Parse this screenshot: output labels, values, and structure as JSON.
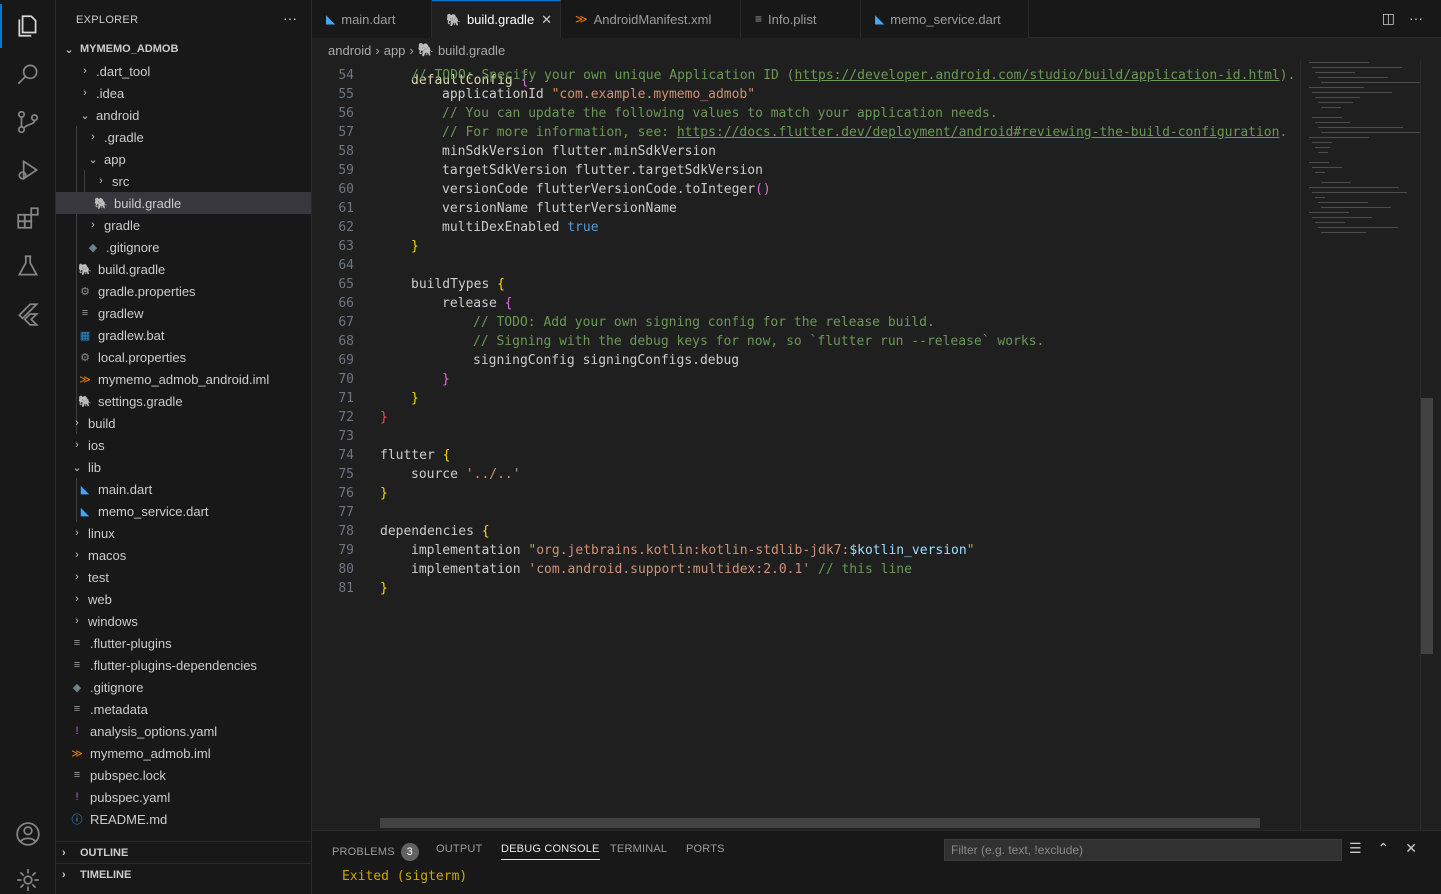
{
  "activity_bar": {
    "icons": [
      "explorer-icon",
      "search-icon",
      "source-control-icon",
      "run-debug-icon",
      "extensions-icon",
      "testing-icon",
      "flutter-icon",
      "account-icon",
      "settings-gear-icon"
    ]
  },
  "sidebar": {
    "title": "EXPLORER",
    "more": "···",
    "project": "MYMEMO_ADMOB",
    "items": [
      {
        "label": ".dart_tool",
        "chev": "›",
        "icon": ""
      },
      {
        "label": ".idea",
        "chev": "›",
        "icon": ""
      },
      {
        "label": "android",
        "chev": "⌄",
        "icon": ""
      },
      {
        "label": ".gradle",
        "chev": "›",
        "icon": ""
      },
      {
        "label": "app",
        "chev": "⌄",
        "icon": ""
      },
      {
        "label": "src",
        "chev": "›",
        "icon": ""
      },
      {
        "label": "build.gradle",
        "chev": "",
        "icon": "🐘"
      },
      {
        "label": "gradle",
        "chev": "›",
        "icon": ""
      },
      {
        "label": ".gitignore",
        "chev": "",
        "icon": "◆"
      },
      {
        "label": "build.gradle",
        "chev": "",
        "icon": "🐘"
      },
      {
        "label": "gradle.properties",
        "chev": "",
        "icon": "⚙"
      },
      {
        "label": "gradlew",
        "chev": "",
        "icon": "≡"
      },
      {
        "label": "gradlew.bat",
        "chev": "",
        "icon": "▦"
      },
      {
        "label": "local.properties",
        "chev": "",
        "icon": "⚙"
      },
      {
        "label": "mymemo_admob_android.iml",
        "chev": "",
        "icon": "≫"
      },
      {
        "label": "settings.gradle",
        "chev": "",
        "icon": "🐘"
      },
      {
        "label": "build",
        "chev": "›",
        "icon": ""
      },
      {
        "label": "ios",
        "chev": "›",
        "icon": ""
      },
      {
        "label": "lib",
        "chev": "⌄",
        "icon": ""
      },
      {
        "label": "main.dart",
        "chev": "",
        "icon": "◣"
      },
      {
        "label": "memo_service.dart",
        "chev": "",
        "icon": "◣"
      },
      {
        "label": "linux",
        "chev": "›",
        "icon": ""
      },
      {
        "label": "macos",
        "chev": "›",
        "icon": ""
      },
      {
        "label": "test",
        "chev": "›",
        "icon": ""
      },
      {
        "label": "web",
        "chev": "›",
        "icon": ""
      },
      {
        "label": "windows",
        "chev": "›",
        "icon": ""
      },
      {
        "label": ".flutter-plugins",
        "chev": "",
        "icon": "≡"
      },
      {
        "label": ".flutter-plugins-dependencies",
        "chev": "",
        "icon": "≡"
      },
      {
        "label": ".gitignore",
        "chev": "",
        "icon": "◆"
      },
      {
        "label": ".metadata",
        "chev": "",
        "icon": "≡"
      },
      {
        "label": "analysis_options.yaml",
        "chev": "",
        "icon": "!"
      },
      {
        "label": "mymemo_admob.iml",
        "chev": "",
        "icon": "≫"
      },
      {
        "label": "pubspec.lock",
        "chev": "",
        "icon": "≡"
      },
      {
        "label": "pubspec.yaml",
        "chev": "",
        "icon": "!"
      },
      {
        "label": "README.md",
        "chev": "",
        "icon": "ⓘ"
      }
    ],
    "sections": [
      "OUTLINE",
      "TIMELINE"
    ]
  },
  "tabs": [
    {
      "label": "main.dart",
      "icon": "◣"
    },
    {
      "label": "build.gradle",
      "icon": "🐘",
      "close": "✕"
    },
    {
      "label": "AndroidManifest.xml",
      "icon": "≫"
    },
    {
      "label": "Info.plist",
      "icon": "≡"
    },
    {
      "label": "memo_service.dart",
      "icon": "◣"
    }
  ],
  "tab_actions": {
    "split": "◫",
    "more": "···"
  },
  "breadcrumb": [
    "android",
    "›",
    "app",
    "›",
    "🐘",
    "build.gradle"
  ],
  "editor": {
    "line_numbers": [
      "54",
      "55",
      "56",
      "57",
      "58",
      "59",
      "60",
      "61",
      "62",
      "63",
      "64",
      "65",
      "66",
      "67",
      "68",
      "69",
      "70",
      "71",
      "72",
      "73",
      "74",
      "75",
      "76",
      "77",
      "78",
      "79",
      "80",
      "81"
    ]
  },
  "panel": {
    "tabs": [
      "PROBLEMS",
      "OUTPUT",
      "DEBUG CONSOLE",
      "TERMINAL",
      "PORTS"
    ],
    "problems_count": "3",
    "filter_placeholder": "Filter (e.g. text, !exclude)",
    "icons": {
      "wrap": "☰",
      "maximize": "⌃",
      "close": "✕"
    },
    "console_output": "Exited (sigterm)"
  },
  "colors": {
    "accent": "#0078d4",
    "background": "#1f1f1f",
    "sidebar": "#181818"
  }
}
